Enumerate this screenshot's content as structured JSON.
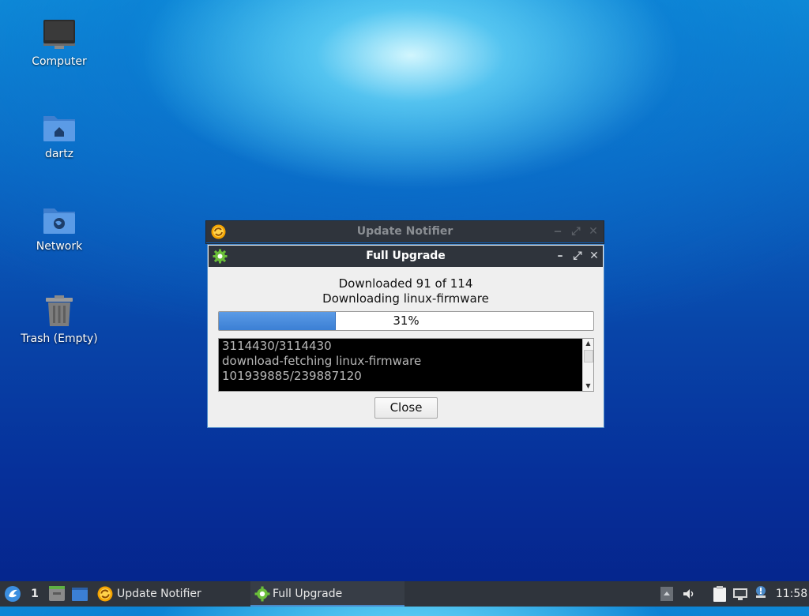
{
  "desktop": {
    "icons": [
      {
        "label": "Computer",
        "icon": "monitor-icon"
      },
      {
        "label": "dartz",
        "icon": "home-folder-icon"
      },
      {
        "label": "Network",
        "icon": "network-folder-icon"
      },
      {
        "label": "Trash (Empty)",
        "icon": "trash-icon"
      }
    ]
  },
  "background_window": {
    "title": "Update Notifier",
    "icon": "update-notifier-icon",
    "buttons": {
      "minimize": "‒",
      "maximize": "⤢",
      "close": "✕"
    }
  },
  "dialog": {
    "title": "Full Upgrade",
    "icon": "gear-icon",
    "buttons": {
      "minimize": "–",
      "maximize": "⤢",
      "close": "✕"
    },
    "status_line1": "Downloaded 91 of 114",
    "status_line2": "Downloading linux-firmware",
    "progress_percent": 31,
    "progress_label": "31%",
    "log_lines": [
      "3114430/3114430",
      "download-fetching linux-firmware",
      "101939885/239887120"
    ],
    "close_label": "Close"
  },
  "taskbar": {
    "workspace": "1",
    "tasks": [
      {
        "label": "Update Notifier",
        "icon": "update-notifier-icon",
        "active": false
      },
      {
        "label": "Full Upgrade",
        "icon": "gear-icon",
        "active": true
      }
    ],
    "clock": "11:58",
    "tray_icons": [
      "scroll-up-icon",
      "volume-icon",
      "clipboard-icon",
      "network-icon",
      "notification-icon"
    ]
  },
  "colors": {
    "accent": "#4a89c8",
    "titlebar": "#2f343c",
    "progress_fill": "#3b7fd4"
  }
}
